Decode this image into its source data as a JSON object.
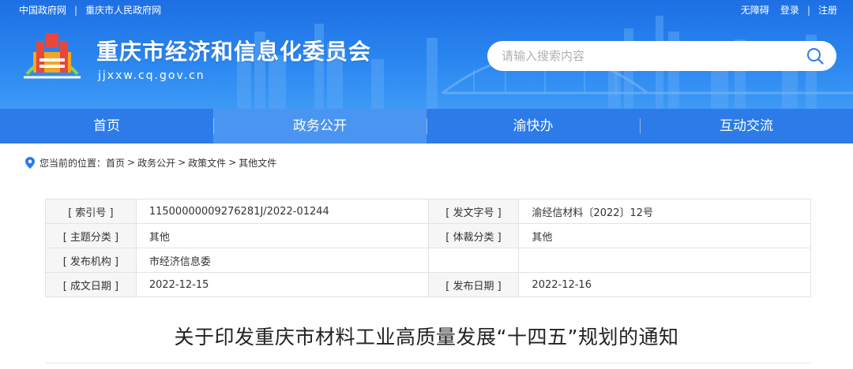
{
  "topbar": {
    "links_left": [
      "中国政府网",
      "重庆市人民政府网"
    ],
    "accessibility": "无障碍",
    "login": "登录",
    "register": "注册"
  },
  "header": {
    "title": "重庆市经济和信息化委员会",
    "domain": "jjxxw.cq.gov.cn",
    "search_placeholder": "请输入搜索内容"
  },
  "nav": {
    "items": [
      {
        "label": "首页",
        "active": false
      },
      {
        "label": "政务公开",
        "active": true
      },
      {
        "label": "渝快办",
        "active": false
      },
      {
        "label": "互动交流",
        "active": false
      }
    ]
  },
  "breadcrumb": {
    "prefix": "您当前的位置：",
    "items": [
      "首页",
      "政务公开",
      "政策文件",
      "其他文件"
    ]
  },
  "meta": {
    "index_label": "[ 索引号 ]",
    "index_value": "11500000009276281J/2022-01244",
    "docno_label": "[ 发文字号 ]",
    "docno_value": "渝经信材料〔2022〕12号",
    "topic_label": "[ 主题分类 ]",
    "topic_value": "其他",
    "genre_label": "[ 体裁分类 ]",
    "genre_value": "其他",
    "issuer_label": "[ 发布机构 ]",
    "issuer_value": "市经济信息委",
    "created_label": "[ 成文日期 ]",
    "created_value": "2022-12-15",
    "published_label": "[ 发布日期 ]",
    "published_value": "2022-12-16"
  },
  "article": {
    "title": "关于印发重庆市材料工业高质量发展“十四五”规划的通知"
  },
  "colors": {
    "banner": "#2a86f0",
    "nav": "#2c7be8",
    "nav_active": "#4b95f2"
  }
}
